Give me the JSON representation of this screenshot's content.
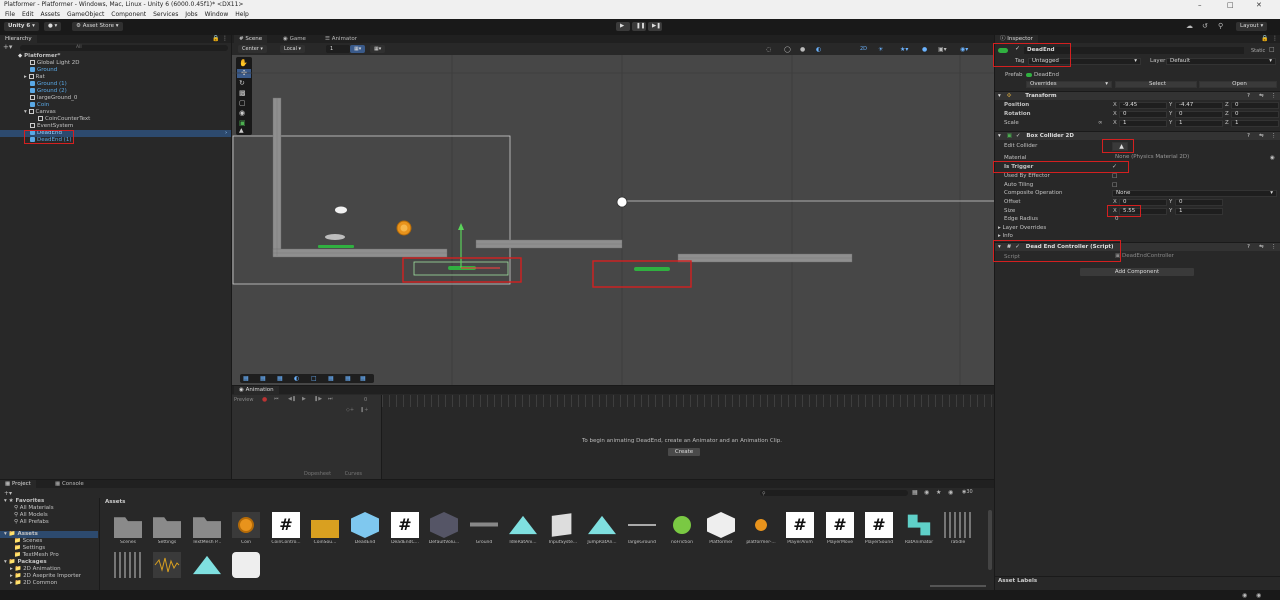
{
  "window": {
    "title": "Platformer - Platformer - Windows, Mac, Linux - Unity 6 (6000.0.45f1)* <DX11>"
  },
  "menu": [
    "File",
    "Edit",
    "Assets",
    "GameObject",
    "Component",
    "Services",
    "Jobs",
    "Window",
    "Help"
  ],
  "toolbar": {
    "account": "Unity 6",
    "asset_store": "Asset Store",
    "layout": "Layout"
  },
  "hierarchy": {
    "tab": "Hierarchy",
    "search_placeholder": "All",
    "items": [
      {
        "label": "Platformer*"
      },
      {
        "label": "Global Light 2D"
      },
      {
        "label": "Ground"
      },
      {
        "label": "Rat"
      },
      {
        "label": "Ground (1)"
      },
      {
        "label": "Ground (2)"
      },
      {
        "label": "largeGround_0"
      },
      {
        "label": "Coin"
      },
      {
        "label": "Canvas"
      },
      {
        "label": "CoinCounterText"
      },
      {
        "label": "EventSystem"
      },
      {
        "label": "DeadEnd"
      },
      {
        "label": "DeadEnd (1)"
      }
    ]
  },
  "scene": {
    "tabs": [
      "Scene",
      "Game",
      "Animator"
    ],
    "pivot": "Center",
    "space": "Local",
    "grid_snap": "1"
  },
  "animation": {
    "tab": "Animation",
    "preview": "Preview",
    "frame": "0",
    "message": "To begin animating DeadEnd, create an Animator and an Animation Clip.",
    "create": "Create",
    "dopesheet": "Dopesheet",
    "curves": "Curves"
  },
  "inspector": {
    "tab": "Inspector",
    "object_name": "DeadEnd",
    "static": "Static",
    "tag_label": "Tag",
    "tag_value": "Untagged",
    "layer_label": "Layer",
    "layer_value": "Default",
    "prefab_label": "Prefab",
    "prefab_value": "DeadEnd",
    "overrides": "Overrides",
    "select": "Select",
    "open": "Open",
    "transform": {
      "title": "Transform",
      "position_label": "Position",
      "rotation_label": "Rotation",
      "scale_label": "Scale",
      "position": {
        "x": "-9.45",
        "y": "-4.47",
        "z": "0"
      },
      "rotation": {
        "x": "0",
        "y": "0",
        "z": "0"
      },
      "scale": {
        "x": "1",
        "y": "1",
        "z": "1"
      }
    },
    "box_collider": {
      "title": "Box Collider 2D",
      "edit_collider": "Edit Collider",
      "material": "Material",
      "material_value": "None (Physics Material 2D)",
      "is_trigger": "Is Trigger",
      "used_by_effector": "Used By Effector",
      "auto_tiling": "Auto Tiling",
      "composite_operation": "Composite Operation",
      "composite_value": "None",
      "offset": "Offset",
      "offset_x": "0",
      "offset_y": "0",
      "size": "Size",
      "size_x": "5.55",
      "size_y": "1",
      "edge_radius": "Edge Radius",
      "edge_radius_value": "0",
      "layer_overrides": "Layer Overrides",
      "info": "Info"
    },
    "script_comp": {
      "title": "Dead End Controller (Script)",
      "script_label": "Script",
      "script_value": "DeadEndController"
    },
    "add_component": "Add Component",
    "asset_labels": "Asset Labels"
  },
  "project": {
    "tabs": [
      "Project",
      "Console"
    ],
    "favorites": {
      "title": "Favorites",
      "items": [
        "All Materials",
        "All Models",
        "All Prefabs"
      ]
    },
    "assets_tree": {
      "title": "Assets",
      "items": [
        "Scenes",
        "Settings",
        "TextMesh Pro"
      ]
    },
    "packages": {
      "title": "Packages",
      "items": [
        "2D Animation",
        "2D Aseprite Importer",
        "2D Common"
      ]
    },
    "breadcrumb": "Assets",
    "hidden_count": "30",
    "assets": [
      {
        "label": "Scenes"
      },
      {
        "label": "Settings"
      },
      {
        "label": "TextMesh P..."
      },
      {
        "label": "Coin"
      },
      {
        "label": "CoinContro..."
      },
      {
        "label": "CoinSou..."
      },
      {
        "label": "DeadEnd"
      },
      {
        "label": "DeadEndC..."
      },
      {
        "label": "DefaultVolu..."
      },
      {
        "label": "Ground"
      },
      {
        "label": "IdleRatAni..."
      },
      {
        "label": "InputSyste..."
      },
      {
        "label": "JumpRatAn..."
      },
      {
        "label": "largeGround"
      },
      {
        "label": "noFriction"
      },
      {
        "label": "Platformer"
      },
      {
        "label": "platformer-..."
      },
      {
        "label": "PlayerAnim"
      },
      {
        "label": "PlayerMove"
      },
      {
        "label": "PlayerSound"
      },
      {
        "label": "RatAnimator"
      },
      {
        "label": "ratidle"
      }
    ]
  }
}
